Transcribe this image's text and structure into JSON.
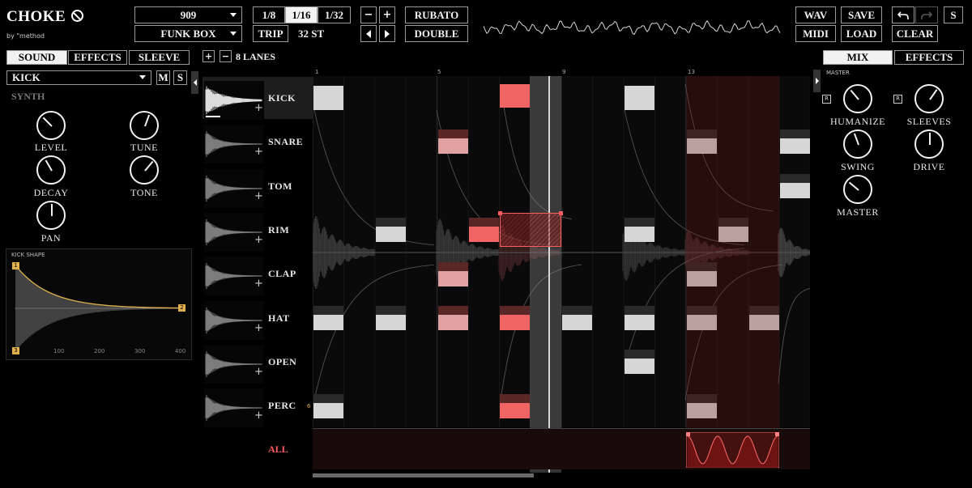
{
  "app": {
    "title": "CHOKE",
    "byline": "by \"method"
  },
  "header": {
    "kit_select": "909",
    "pattern_select": "FUNK BOX",
    "resolutions": [
      "1/8",
      "1/16",
      "1/32"
    ],
    "selected_resolution": "1/16",
    "trip_label": "TRIP",
    "steps_label": "32 ST",
    "rubato_label": "RUBATO",
    "double_label": "DOUBLE",
    "wav_label": "WAV",
    "midi_label": "MIDI",
    "save_label": "SAVE",
    "load_label": "LOAD",
    "clear_label": "CLEAR",
    "s_label": "S",
    "minus_label": "−",
    "plus_label": "+"
  },
  "left": {
    "tabs": [
      "SOUND",
      "EFFECTS",
      "SLEEVE"
    ],
    "active_tab": "SOUND",
    "sound_select": "KICK",
    "mute_label": "M",
    "solo_label": "S",
    "section_label": "SYNTH",
    "knobs": [
      {
        "label": "LEVEL",
        "angle": -45
      },
      {
        "label": "TUNE",
        "angle": 20
      },
      {
        "label": "DECAY",
        "angle": -30
      },
      {
        "label": "TONE",
        "angle": 40
      },
      {
        "label": "PAN",
        "angle": 0
      }
    ],
    "shape_title": "KICK SHAPE",
    "shape_ticks": [
      "100",
      "200",
      "300",
      "400"
    ],
    "shape_handles": [
      "1",
      "2",
      "3"
    ]
  },
  "lanes_header": {
    "lanes_label": "8 LANES",
    "add": "+",
    "remove": "−"
  },
  "lanes": [
    "KICK",
    "SNARE",
    "TOM",
    "RIM",
    "CLAP",
    "HAT",
    "OPEN",
    "PERC"
  ],
  "all_label": "ALL",
  "ruler": [
    "1",
    "5",
    "9",
    "13"
  ],
  "perc_marker": "6",
  "right": {
    "tabs": [
      "MIX",
      "EFFECTS"
    ],
    "active_tab": "MIX",
    "section_label": "MASTER",
    "r_badge": "R",
    "knobs": [
      {
        "label": "HUMANIZE",
        "angle": -40,
        "badge": true
      },
      {
        "label": "SLEEVES",
        "angle": 35,
        "badge": true
      },
      {
        "label": "SWING",
        "angle": -20,
        "badge": false
      },
      {
        "label": "DRIVE",
        "angle": 0,
        "badge": false
      },
      {
        "label": "MASTER",
        "angle": -50,
        "badge": false
      }
    ]
  },
  "colors": {
    "note_white": "#d6d6d6",
    "note_dark": "#2a2a2a",
    "note_red": "#f06464",
    "note_pink": "#dfa1a1",
    "note_dark_red": "#5a2626",
    "accent_red": "#ff5d5d",
    "panel_border": "#444444"
  }
}
